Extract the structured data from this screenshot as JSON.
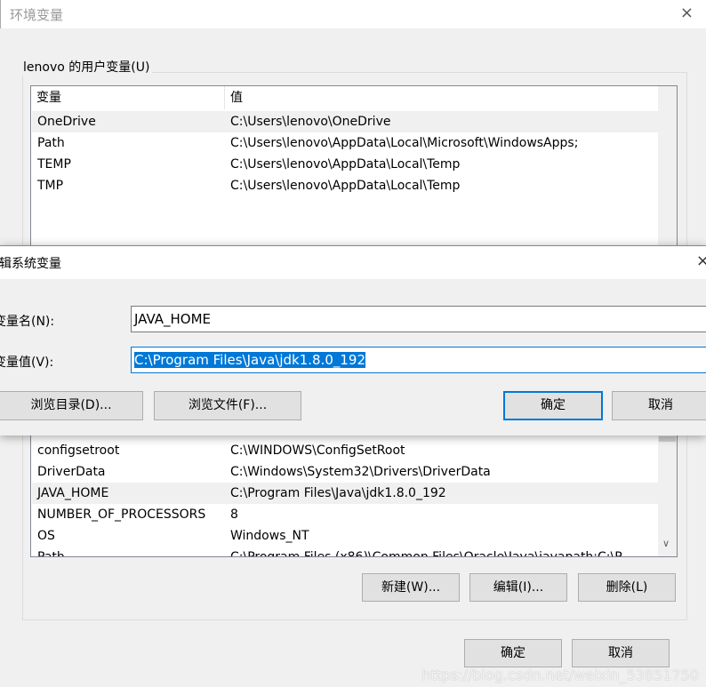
{
  "window": {
    "title": "环境变量",
    "close_icon": "×"
  },
  "user_vars": {
    "group_label": "lenovo 的用户变量(U)",
    "headers": [
      "变量",
      "值"
    ],
    "rows": [
      [
        "OneDrive",
        "C:\\Users\\lenovo\\OneDrive"
      ],
      [
        "Path",
        "C:\\Users\\lenovo\\AppData\\Local\\Microsoft\\WindowsApps;"
      ],
      [
        "TEMP",
        "C:\\Users\\lenovo\\AppData\\Local\\Temp"
      ],
      [
        "TMP",
        "C:\\Users\\lenovo\\AppData\\Local\\Temp"
      ]
    ]
  },
  "system_vars": {
    "rows": [
      [
        "configsetroot",
        "C:\\WINDOWS\\ConfigSetRoot"
      ],
      [
        "DriverData",
        "C:\\Windows\\System32\\Drivers\\DriverData"
      ],
      [
        "JAVA_HOME",
        "C:\\Program Files\\Java\\jdk1.8.0_192"
      ],
      [
        "NUMBER_OF_PROCESSORS",
        "8"
      ],
      [
        "OS",
        "Windows_NT"
      ],
      [
        "Path",
        "C:\\Program Files (x86)\\Common Files\\Oracle\\Java\\javapath;C:\\P"
      ]
    ],
    "selected": "JAVA_HOME",
    "new_button": "新建(W)...",
    "edit_button": "编辑(I)...",
    "delete_button": "删除(L)"
  },
  "footer": {
    "ok": "确定",
    "cancel": "取消"
  },
  "edit_dialog": {
    "title": "编辑系统变量",
    "close_icon": "×",
    "name_label": "变量名(N):",
    "name_value": "JAVA_HOME",
    "value_label": "变量值(V):",
    "value_value": "C:\\Program Files\\Java\\jdk1.8.0_192",
    "browse_dir": "浏览目录(D)...",
    "browse_file": "浏览文件(F)...",
    "ok": "确定",
    "cancel": "取消"
  },
  "watermark": "https://blog.csdn.net/weixin_53851750"
}
